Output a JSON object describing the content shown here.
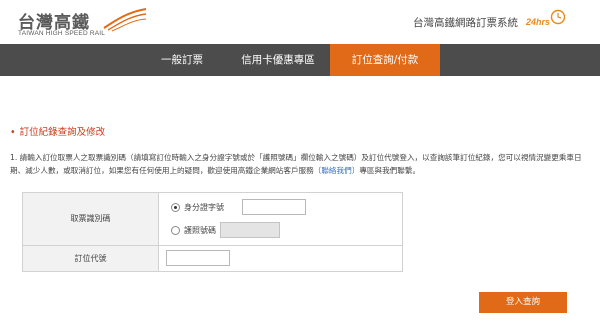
{
  "header": {
    "logo_name": "台灣高鐵",
    "logo_sub": "TAIWAN HIGH SPEED RAIL",
    "system_title": "台灣高鐵網路訂票系統",
    "badge_24": "24hrs"
  },
  "nav": {
    "items": [
      {
        "label": "一般訂票",
        "active": false
      },
      {
        "label": "信用卡優惠專區",
        "active": false
      },
      {
        "label": "訂位查詢/付款",
        "active": true
      }
    ]
  },
  "section": {
    "bullet": "•",
    "title": "訂位紀錄查詢及修改"
  },
  "instructions": {
    "number": "1.",
    "text_before_link": "請輸入訂位取票人之取票識別碼（請填寫訂位時輸入之身分證字號或於「護照號碼」欄位輸入之號碼）及訂位代號登入，以查詢該筆訂位紀錄，您可以視情況變更乘車日期、減少人數，或取消訂位，如果您有任何使用上的疑問，歡迎使用高鐵企業網站客戶服務",
    "link": "〔聯絡我們〕",
    "text_after_link": "專區與我們聯繫。"
  },
  "form": {
    "id_label": "取票識別碼",
    "option_id": "身分證字號",
    "option_passport": "護照號碼",
    "id_value": "",
    "passport_value": "",
    "selected": "id",
    "booking_code_label": "訂位代號",
    "booking_code_value": ""
  },
  "submit_label": "登入查詢",
  "colors": {
    "accent": "#e06a17",
    "nav_bg": "#4c4c4c",
    "section_title": "#cc3a1b",
    "link": "#3b6fc1"
  }
}
